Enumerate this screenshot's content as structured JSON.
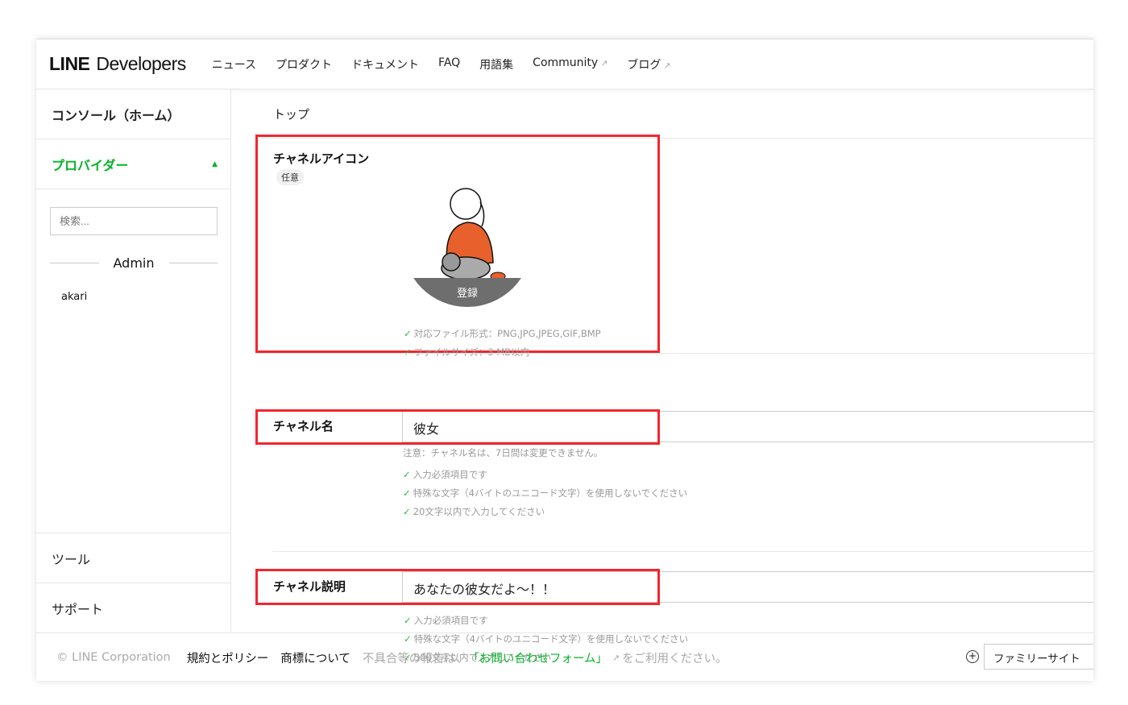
{
  "header": {
    "logo_line": "LINE",
    "logo_dev": "Developers",
    "nav": [
      {
        "label": "ニュース"
      },
      {
        "label": "プロダクト"
      },
      {
        "label": "ドキュメント"
      },
      {
        "label": "FAQ"
      },
      {
        "label": "用語集"
      },
      {
        "label": "Community",
        "external": true
      },
      {
        "label": "ブログ",
        "external": true
      }
    ]
  },
  "sidebar": {
    "console": "コンソール（ホーム）",
    "provider": "プロバイダー",
    "search_placeholder": "検索...",
    "section": "Admin",
    "items": [
      "akari"
    ],
    "tools": "ツール",
    "support": "サポート"
  },
  "main": {
    "breadcrumb": "トップ",
    "icon_field": {
      "label": "チャネルアイコン",
      "tag": "任意",
      "overlay": "登録",
      "hints": [
        "対応ファイル形式：PNG,JPG,JPEG,GIF,BMP",
        "ファイルサイズ：3 MB以内"
      ]
    },
    "name_field": {
      "label": "チャネル名",
      "value": "彼女",
      "note": "注意：チャネル名は、7日間は変更できません。",
      "hints": [
        "入力必須項目です",
        "特殊な文字（4バイトのユニコード文字）を使用しないでください",
        "20文字以内で入力してください"
      ]
    },
    "desc_field": {
      "label": "チャネル説明",
      "value": "あなたの彼女だよ〜！！",
      "hints": [
        "入力必須項目です",
        "特殊な文字（4バイトのユニコード文字）を使用しないでください",
        "500文字以内で入力してください"
      ]
    }
  },
  "footer": {
    "copyright": "© LINE Corporation",
    "policy": "規約とポリシー",
    "trademark": "商標について",
    "report_pre": "不具合等の報告は、",
    "contact": "「お問い合わせフォーム」",
    "report_post": "をご利用ください。",
    "family": "ファミリーサイト"
  },
  "colors": {
    "accent": "#06b32a",
    "highlight": "#f2262e"
  }
}
